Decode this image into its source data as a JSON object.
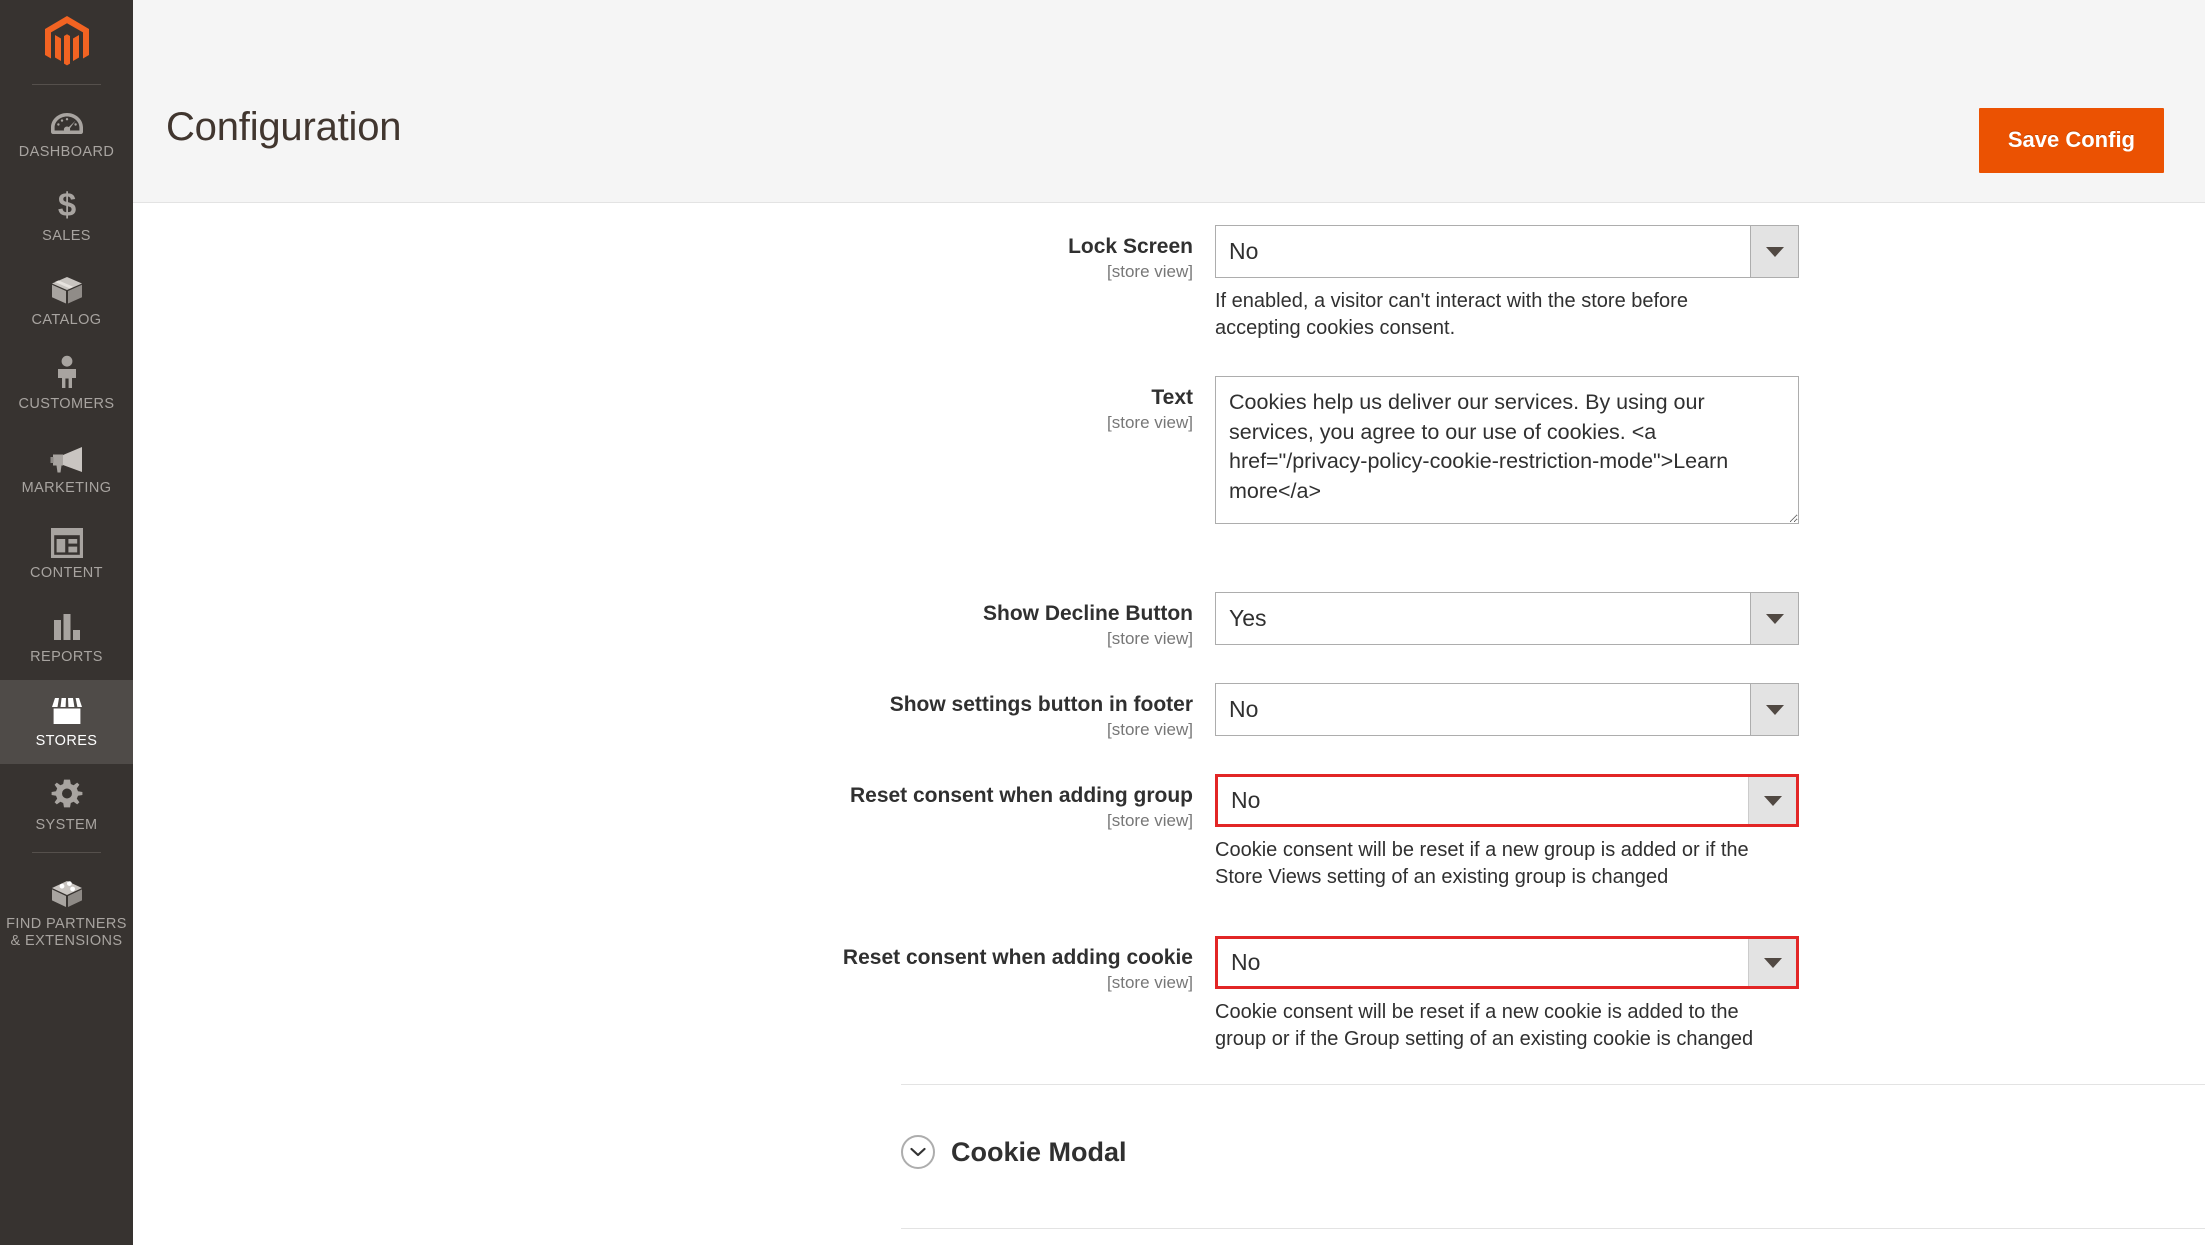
{
  "sidebar": {
    "logo_alt": "magento-logo",
    "items": [
      {
        "label": "DASHBOARD",
        "icon": "dashboard-icon",
        "active": false
      },
      {
        "label": "SALES",
        "icon": "dollar-icon",
        "active": false
      },
      {
        "label": "CATALOG",
        "icon": "box-icon",
        "active": false
      },
      {
        "label": "CUSTOMERS",
        "icon": "person-icon",
        "active": false
      },
      {
        "label": "MARKETING",
        "icon": "megaphone-icon",
        "active": false
      },
      {
        "label": "CONTENT",
        "icon": "layout-icon",
        "active": false
      },
      {
        "label": "REPORTS",
        "icon": "bar-chart-icon",
        "active": false
      },
      {
        "label": "STORES",
        "icon": "storefront-icon",
        "active": true
      },
      {
        "label": "SYSTEM",
        "icon": "gear-icon",
        "active": false
      },
      {
        "label": "FIND PARTNERS\n& EXTENSIONS",
        "icon": "extensions-icon",
        "active": false
      }
    ]
  },
  "header": {
    "title": "Configuration",
    "save_label": "Save Config",
    "accent_color": "#eb5202"
  },
  "form": {
    "scope_label": "[store view]",
    "fields": [
      {
        "name": "lock-screen",
        "label": "Lock Screen",
        "scope": "[store view]",
        "type": "select",
        "value": "No",
        "invalid": false,
        "note": "If enabled, a visitor can't interact with the store before\naccepting cookies consent."
      },
      {
        "name": "text",
        "label": "Text",
        "scope": "[store view]",
        "type": "textarea",
        "value": "Cookies help us deliver our services. By using our services, you agree to our use of cookies. <a href=\"/privacy-policy-cookie-restriction-mode\">Learn more</a>",
        "invalid": false,
        "note": ""
      },
      {
        "name": "show-decline-button",
        "label": "Show Decline Button",
        "scope": "[store view]",
        "type": "select",
        "value": "Yes",
        "invalid": false,
        "note": ""
      },
      {
        "name": "show-settings-button-in-footer",
        "label": "Show settings button in footer",
        "scope": "[store view]",
        "type": "select",
        "value": "No",
        "invalid": false,
        "note": ""
      },
      {
        "name": "reset-consent-when-adding-group",
        "label": "Reset consent when adding group",
        "scope": "[store view]",
        "type": "select",
        "value": "No",
        "invalid": true,
        "note": "Cookie consent will be reset if a new group is added or if the\nStore Views setting of an existing group is changed"
      },
      {
        "name": "reset-consent-when-adding-cookie",
        "label": "Reset consent when adding cookie",
        "scope": "[store view]",
        "type": "select",
        "value": "No",
        "invalid": true,
        "note": "Cookie consent will be reset if a new cookie is added to the\ngroup or if the Group setting of an existing cookie is changed"
      }
    ],
    "error_border_color": "#e22626"
  },
  "sections": [
    {
      "name": "cookie-modal",
      "title": "Cookie Modal",
      "expanded": false
    }
  ]
}
